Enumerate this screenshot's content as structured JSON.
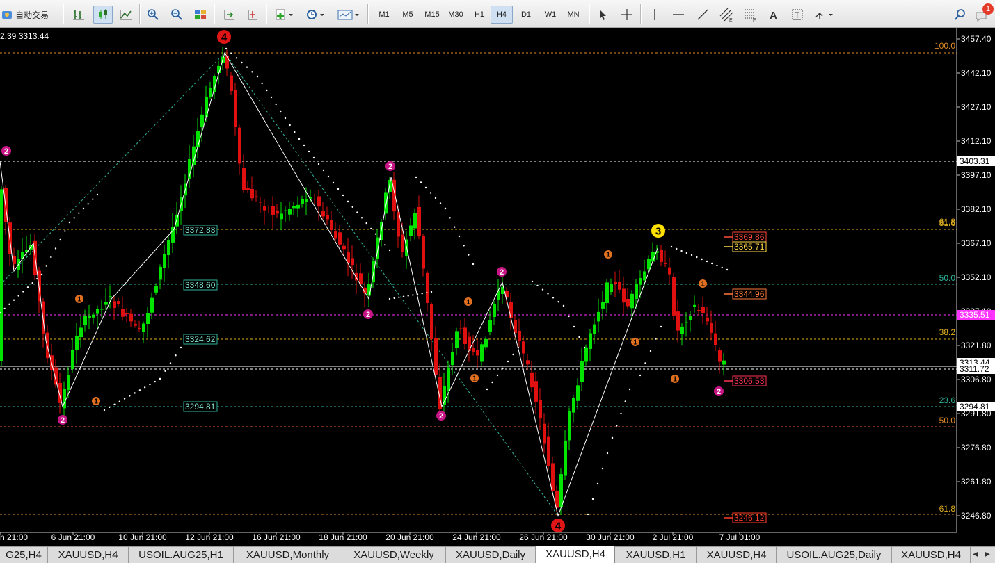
{
  "toolbar": {
    "autotrade_label": "自动交易",
    "timeframes": [
      "M1",
      "M5",
      "M15",
      "M30",
      "H1",
      "H4",
      "D1",
      "W1",
      "MN"
    ],
    "active_timeframe": "H4",
    "notification_count": "1"
  },
  "chart": {
    "header_text": "2.39 3313.44",
    "price_axis_labels": [
      "3457.40",
      "3442.10",
      "3427.10",
      "3412.10",
      "3397.10",
      "3382.10",
      "3367.10",
      "3352.10",
      "3337.10",
      "3321.80",
      "3306.80",
      "3291.80",
      "3276.80",
      "3261.80",
      "3246.80"
    ],
    "time_axis_labels": [
      "n 21:00",
      "6 Jun 21:00",
      "10 Jun 21:00",
      "12 Jun 21:00",
      "16 Jun 21:00",
      "18 Jun 21:00",
      "20 Jun 21:00",
      "24 Jun 21:00",
      "26 Jun 21:00",
      "30 Jun 21:00",
      "2 Jul 21:00",
      "7 Jul 01:00"
    ],
    "axis_badges": [
      {
        "text": "3403.31",
        "style": "white"
      },
      {
        "text": "3335.51",
        "style": "magenta"
      },
      {
        "text": "3313.44",
        "style": "white"
      },
      {
        "text": "3311.72",
        "style": "white"
      },
      {
        "text": "3294.81",
        "style": "white"
      }
    ],
    "fib_labels_left": [
      "3372.88",
      "3348.60",
      "3324.62",
      "3294.81"
    ],
    "fib_labels_right": [
      {
        "text": "100.0",
        "color": "#e08a2a"
      },
      {
        "text": "61.8",
        "color": "#e0b020"
      },
      {
        "text": "81.6",
        "color": "#e0b020"
      },
      {
        "text": "50.0",
        "color": "#2fb39a"
      },
      {
        "text": "38.2",
        "color": "#e0b020"
      },
      {
        "text": "23.6",
        "color": "#2fb39a"
      },
      {
        "text": "50.0",
        "color": "#e08a2a"
      },
      {
        "text": "61.8",
        "color": "#e0b020"
      }
    ],
    "price_boxes": [
      {
        "text": "3369.86",
        "color": "#ff4a3a"
      },
      {
        "text": "3365.71",
        "color": "#ffd84a"
      },
      {
        "text": "3344.96",
        "color": "#ff7a3a"
      },
      {
        "text": "3306.53",
        "color": "#ff3355"
      },
      {
        "text": "3246.12",
        "color": "#ff3a2a"
      }
    ],
    "wave_markers": [
      {
        "label": "4",
        "kind": "red"
      },
      {
        "label": "2",
        "kind": "magenta"
      },
      {
        "label": "2",
        "kind": "magenta"
      },
      {
        "label": "2",
        "kind": "magenta"
      },
      {
        "label": "2",
        "kind": "magenta"
      },
      {
        "label": "2",
        "kind": "magenta"
      },
      {
        "label": "2",
        "kind": "magenta"
      },
      {
        "label": "2",
        "kind": "magenta"
      },
      {
        "label": "3",
        "kind": "yellow"
      },
      {
        "label": "4",
        "kind": "red"
      },
      {
        "label": "1",
        "kind": "orange"
      },
      {
        "label": "1",
        "kind": "orange"
      },
      {
        "label": "1",
        "kind": "orange"
      },
      {
        "label": "1",
        "kind": "orange"
      },
      {
        "label": "1",
        "kind": "orange"
      },
      {
        "label": "1",
        "kind": "orange"
      },
      {
        "label": "1",
        "kind": "orange"
      },
      {
        "label": "1",
        "kind": "orange"
      }
    ]
  },
  "tabs": [
    {
      "label": "G25,H4"
    },
    {
      "label": "XAUUSD,H4"
    },
    {
      "label": "USOIL.AUG25,H1"
    },
    {
      "label": "XAUUSD,Monthly"
    },
    {
      "label": "XAUUSD,Weekly"
    },
    {
      "label": "XAUUSD,Daily"
    },
    {
      "label": "XAUUSD,H4",
      "active": true
    },
    {
      "label": "XAUUSD,H1"
    },
    {
      "label": "XAUUSD,H4"
    },
    {
      "label": "USOIL.AUG25,Daily"
    },
    {
      "label": "XAUUSD,H4"
    }
  ],
  "colors": {
    "bull": "#00e400",
    "bear": "#e01010",
    "zigzag": "#ffffff"
  }
}
